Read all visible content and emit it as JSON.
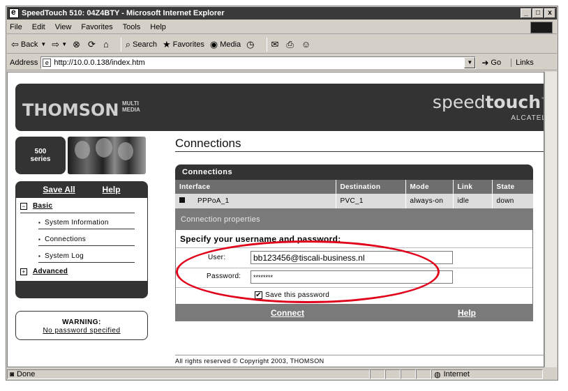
{
  "window": {
    "title": "SpeedTouch 510: 04Z4BTY - Microsoft Internet Explorer",
    "controls": [
      "_",
      "□",
      "x"
    ]
  },
  "menu": [
    "File",
    "Edit",
    "View",
    "Favorites",
    "Tools",
    "Help"
  ],
  "toolbar": {
    "back": "Back",
    "search": "Search",
    "favorites": "Favorites",
    "media": "Media"
  },
  "address": {
    "label": "Address",
    "url": "http://10.0.0.138/index.htm",
    "go": "Go",
    "links": "Links"
  },
  "banner": {
    "brand": "THOMSON",
    "brand_sub_1": "MULTI",
    "brand_sub_2": "MEDIA",
    "product_light": "speed",
    "product_bold": "touch",
    "tm": "™",
    "vendor": "ALCATEL"
  },
  "series": {
    "line1": "500",
    "line2": "series"
  },
  "nav": {
    "save_all": "Save All",
    "help": "Help",
    "basic": {
      "toggle": "−",
      "label": "Basic"
    },
    "items": [
      "System Information",
      "Connections",
      "System Log"
    ],
    "advanced": {
      "toggle": "+",
      "label": "Advanced"
    }
  },
  "warning": {
    "title": "WARNING:",
    "message": "No password specified"
  },
  "page": {
    "title": "Connections"
  },
  "connections": {
    "panel_title": "Connections",
    "columns": [
      "Interface",
      "Destination",
      "Mode",
      "Link",
      "State"
    ],
    "rows": [
      {
        "interface": "PPPoA_1",
        "destination": "PVC_1",
        "mode": "always-on",
        "link": "idle",
        "state": "down"
      }
    ]
  },
  "properties": {
    "title": "Connection properties",
    "instruction": "Specify your username and password:",
    "user_label": "User:",
    "user_value": "bb123456@tiscali-business.nl",
    "password_label": "Password:",
    "password_value": "********",
    "save_password_label": "Save this password",
    "save_password_checked": "✔"
  },
  "actions": {
    "connect": "Connect",
    "help": "Help"
  },
  "footer": {
    "copyright": "All rights reserved © Copyright 2003, THOMSON"
  },
  "status": {
    "text": "Done",
    "zone": "Internet"
  },
  "colors": {
    "highlight_ellipse": "#e0001a",
    "panel_dark": "#333333",
    "panel_mid": "#7a7a7a"
  }
}
